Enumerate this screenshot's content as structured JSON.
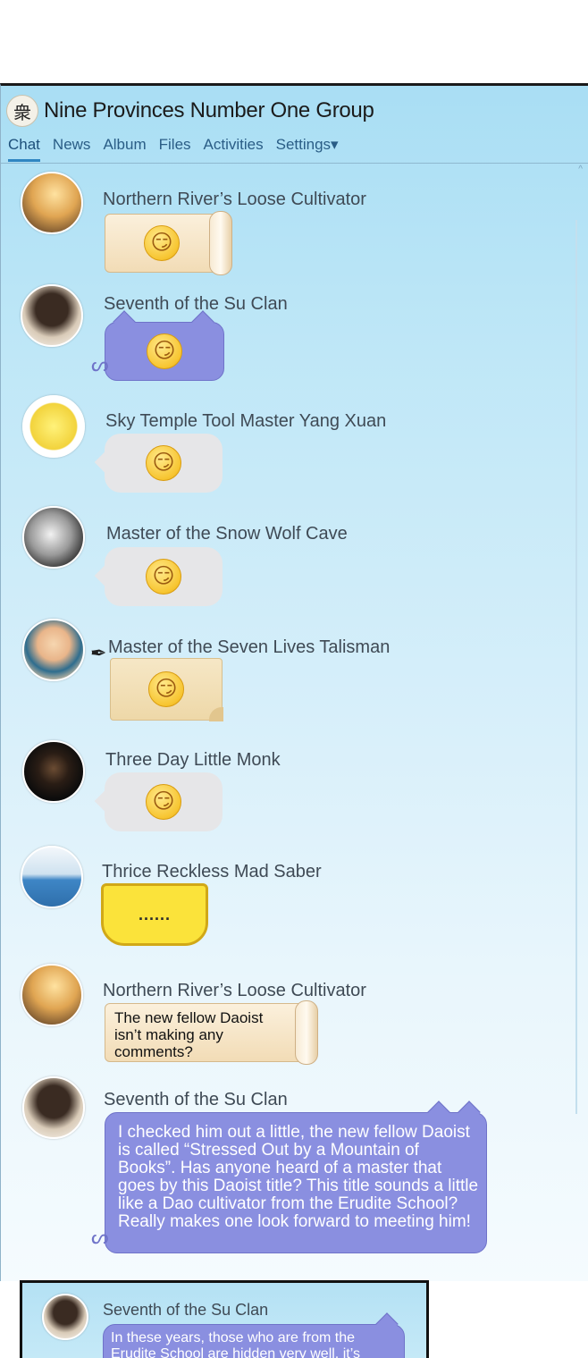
{
  "window": {
    "title": "Nine Provinces Number One Group",
    "logo_glyph": "衆",
    "tabs": [
      {
        "label": "Chat",
        "active": true
      },
      {
        "label": "News"
      },
      {
        "label": "Album"
      },
      {
        "label": "Files"
      },
      {
        "label": "Activities"
      },
      {
        "label": "Settings▾"
      }
    ],
    "scroll_up_glyph": "^"
  },
  "messages": [
    {
      "sender": "Northern River’s Loose Cultivator",
      "bubble": "scroll",
      "content": "emoji",
      "emoji": "😏"
    },
    {
      "sender": "Seventh of the Su Clan",
      "bubble": "cat",
      "content": "emoji",
      "emoji": "😏"
    },
    {
      "sender": "Sky Temple Tool Master Yang Xuan",
      "bubble": "grey",
      "content": "emoji",
      "emoji": "😏"
    },
    {
      "sender": "Master of the Snow Wolf Cave",
      "bubble": "grey",
      "content": "emoji",
      "emoji": "😏"
    },
    {
      "sender": "Master of the Seven Lives Talisman",
      "bubble": "paper",
      "content": "emoji",
      "emoji": "😏"
    },
    {
      "sender": "Three Day Little Monk",
      "bubble": "grey",
      "content": "emoji",
      "emoji": "😏"
    },
    {
      "sender": "Thrice Reckless Mad Saber",
      "bubble": "yellow",
      "content": "text",
      "text": "......"
    },
    {
      "sender": "Northern River’s Loose Cultivator",
      "bubble": "scroll",
      "content": "text",
      "text": "The new fellow Daoist isn’t making any comments?"
    },
    {
      "sender": "Seventh of the Su Clan",
      "bubble": "cat",
      "content": "text",
      "text": "I checked him out a little, the new fellow Daoist is called “Stressed Out by a Mountain of Books”. Has anyone heard of a master that goes by this Daoist title? This title sounds a little like a Dao cultivator from the Erudite School? Really makes one look forward to meeting him!"
    }
  ],
  "inset": {
    "sender": "Seventh of the Su Clan",
    "text": "In these years, those who are from the Erudite School are hidden very well, it’s"
  },
  "colors": {
    "window_top": "#a9def4",
    "cat_bubble": "#8a8fe0",
    "grey_bubble": "#e6e6e8",
    "yellow_bubble": "#fbe33a",
    "tab_active_underline": "#2f86c2"
  },
  "icons": {
    "pen": "✒",
    "cat_tail": "ᔕ"
  }
}
